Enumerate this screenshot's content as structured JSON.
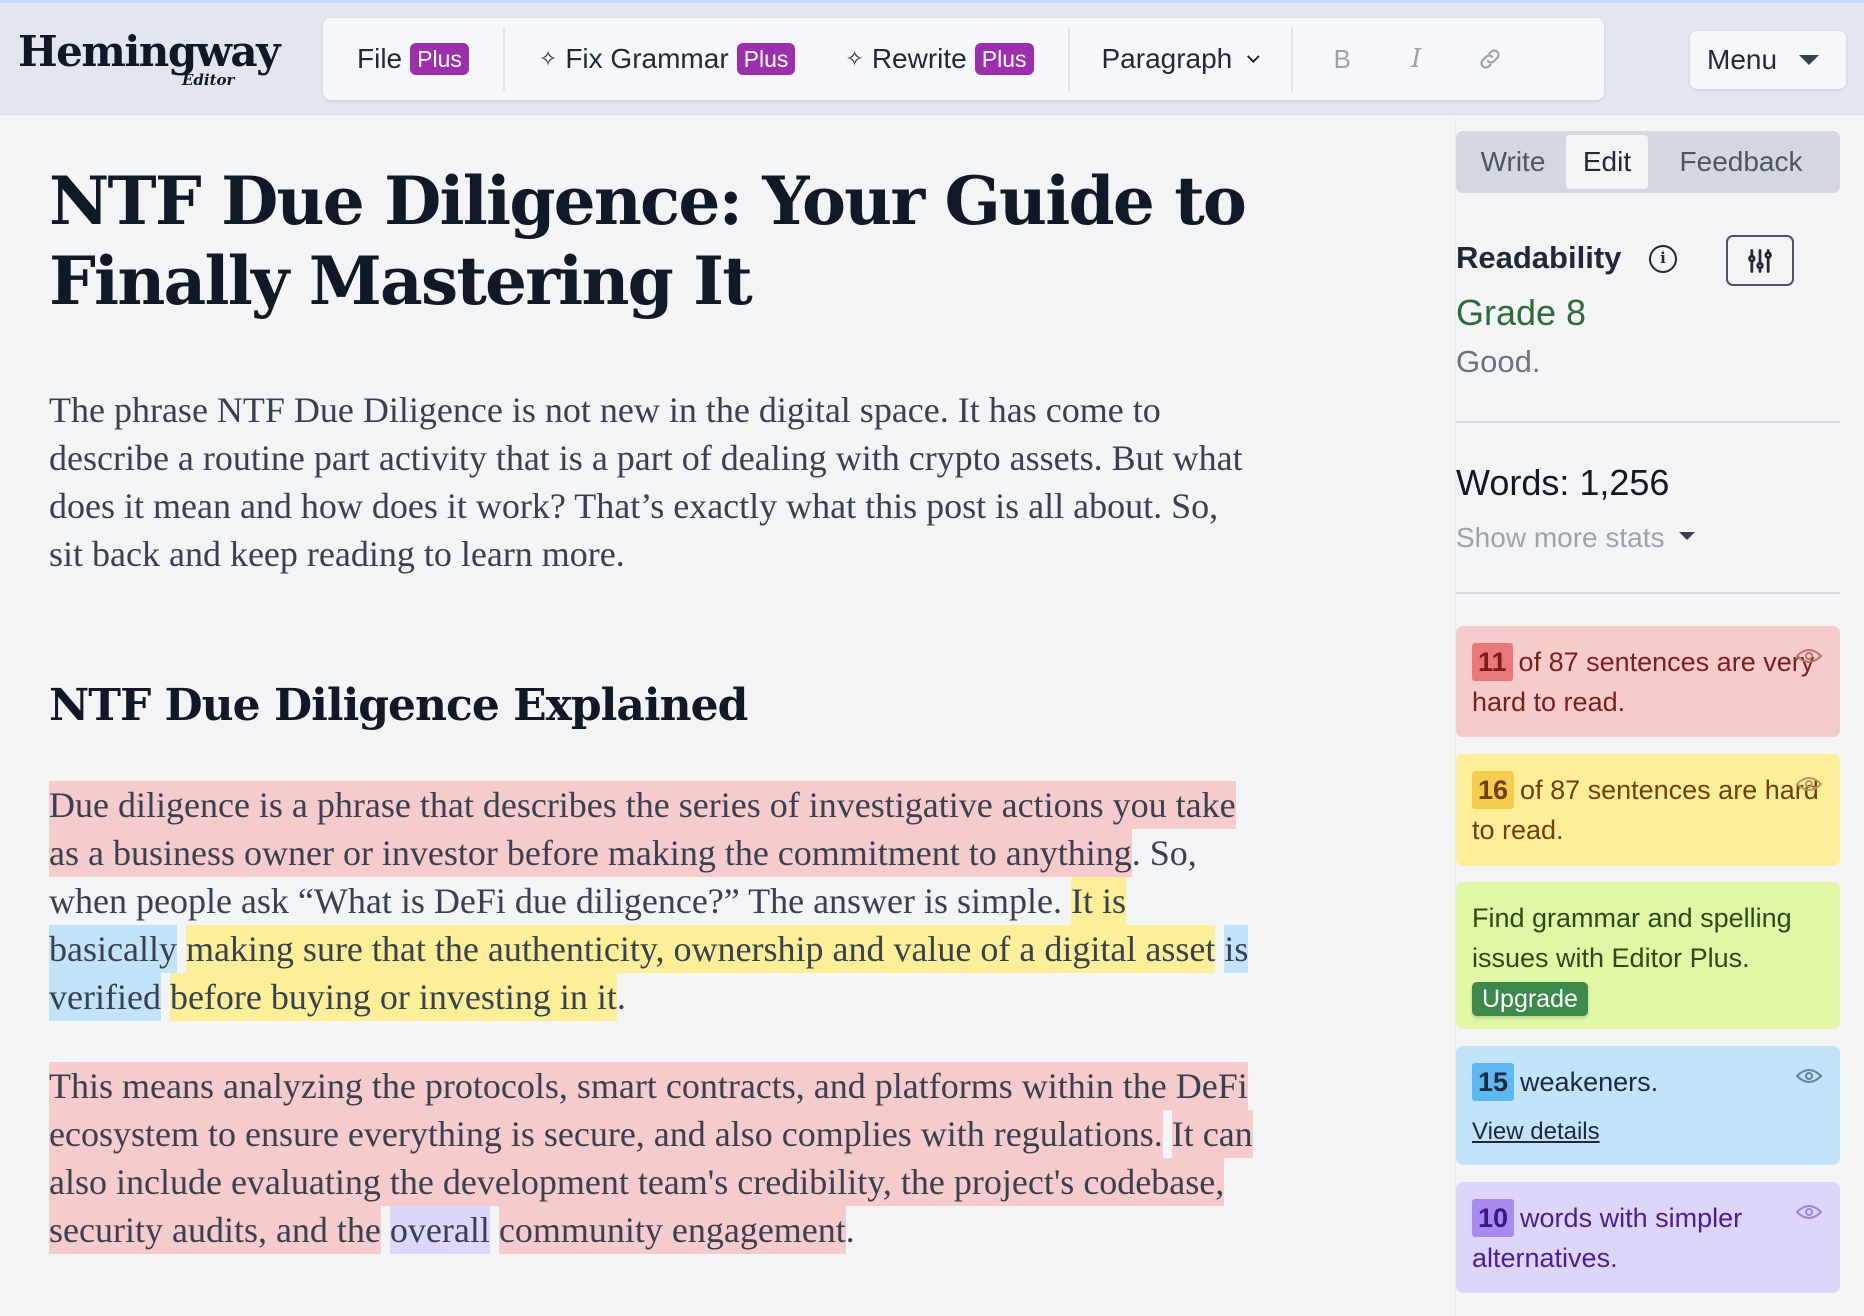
{
  "app": {
    "logo_main": "Hemingway",
    "logo_sub": "Editor"
  },
  "toolbar": {
    "file_label": "File",
    "file_badge": "Plus",
    "fix_grammar_label": "Fix Grammar",
    "fix_grammar_badge": "Plus",
    "rewrite_label": "Rewrite",
    "rewrite_badge": "Plus",
    "paragraph_select": "Paragraph",
    "bold_label": "B",
    "italic_label": "I",
    "menu_label": "Menu"
  },
  "document": {
    "title": "NTF Due Diligence: Your Guide to Finally Mastering It",
    "intro": "The phrase NTF Due Diligence is not new in the digital space. It has come to describe a routine part activity that is  a part of dealing with crypto assets. But what does it mean and how does it work? That’s exactly what this post is all about. So, sit back and keep reading to learn more.",
    "heading2": "NTF Due Diligence Explained",
    "para2": {
      "s1": "Due diligence is a phrase that describes the series of investigative actions you take as a business owner or investor  before making the commitment to anything",
      "s1_end": ". So, when people ask “What is DeFi due diligence?” The answer is simple.  ",
      "s2a": "It is",
      "s2b": "basically",
      "s2c": "making sure that the authenticity, ownership and value of a digital asset",
      "s2d": "is verified",
      "s2e": "before buying or investing in it",
      "end": "."
    },
    "para3": {
      "s1": "This means analyzing the protocols, smart contracts, and platforms within the DeFi ecosystem to ensure everything is secure, and also complies with regulations",
      "s1_end": ".",
      "s2a": "It can also include evaluating the development team's credibility, the project's codebase, security audits, and the",
      "s2b": "overall",
      "s2c": "community engagement",
      "end": "."
    }
  },
  "sidebar": {
    "tabs": [
      "Write",
      "Edit",
      "Feedback"
    ],
    "active_tab": "Edit",
    "readability_label": "Readability",
    "grade": "Grade 8",
    "grade_comment": "Good.",
    "words": "Words: 1,256",
    "show_more": "Show more stats",
    "cards": {
      "very_hard": {
        "count": "11",
        "text": "of 87 sentences are very hard to read.",
        "color": "#f6cbcb"
      },
      "hard": {
        "count": "16",
        "text": "of 87 sentences are hard to read.",
        "color": "#fdef97"
      },
      "grammar": {
        "text": "Find grammar and spelling issues with Editor Plus.",
        "button": "Upgrade",
        "color": "#e1f7a6"
      },
      "weakeners": {
        "count": "15",
        "text": "weakeners.",
        "link": "View details",
        "color": "#c2e3f9"
      },
      "simpler": {
        "count": "10",
        "text": "words with simpler alternatives.",
        "color": "#ddd6fa"
      }
    }
  }
}
